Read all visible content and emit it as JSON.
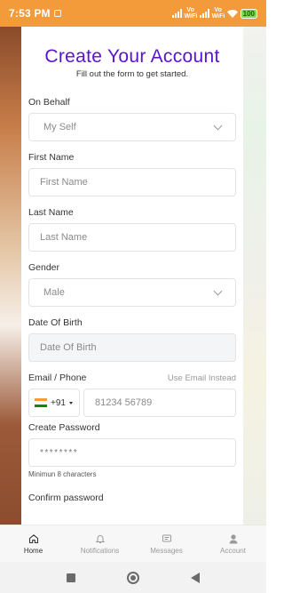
{
  "status_bar": {
    "time": "7:53 PM",
    "signal1_label": "Vo WiFi",
    "signal2_label": "Vo WiFi",
    "battery": "100",
    "colors": {
      "bar": "#f39a3b",
      "battery": "#7ed957"
    }
  },
  "form": {
    "title": "Create Your Account",
    "subtitle": "Fill out the form to get started.",
    "title_color": "#5b12cf",
    "on_behalf": {
      "label": "On Behalf",
      "value": "My Self",
      "icon": "chevron-down-icon"
    },
    "first_name": {
      "label": "First Name",
      "placeholder": "First Name"
    },
    "last_name": {
      "label": "Last Name",
      "placeholder": "Last Name"
    },
    "gender": {
      "label": "Gender",
      "value": "Male",
      "icon": "chevron-down-icon"
    },
    "dob": {
      "label": "Date Of Birth",
      "placeholder": "Date Of Birth"
    },
    "contact": {
      "label": "Email / Phone",
      "toggle": "Use Email Instead",
      "country_code": "+91",
      "country_flag": "india-flag-icon",
      "placeholder": "81234 56789"
    },
    "password": {
      "label": "Create Password",
      "value": "********",
      "hint": "Minimun 8 characters"
    },
    "confirm_password": {
      "label": "Confirm password"
    }
  },
  "bottom_nav": {
    "items": [
      {
        "label": "Home",
        "icon": "home-icon",
        "active": true
      },
      {
        "label": "Notifications",
        "icon": "bell-icon",
        "active": false
      },
      {
        "label": "Messages",
        "icon": "message-icon",
        "active": false
      },
      {
        "label": "Account",
        "icon": "user-icon",
        "active": false
      }
    ]
  },
  "system_nav": {
    "icons": [
      "recents-icon",
      "home-circle-icon",
      "back-icon"
    ]
  }
}
